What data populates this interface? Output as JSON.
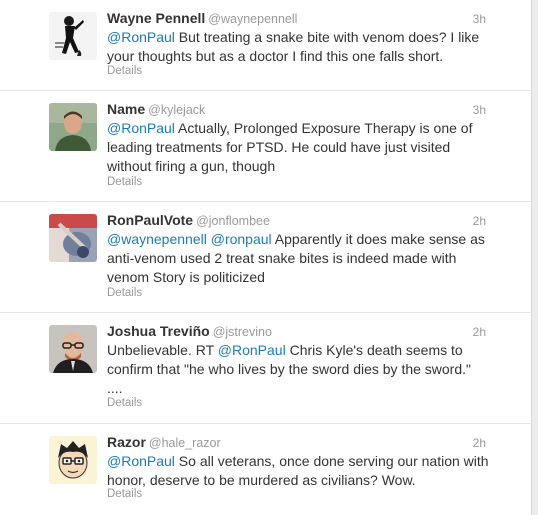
{
  "tweets": [
    {
      "name": "Wayne Pennell",
      "username": "@waynepennell",
      "time": "3h",
      "text": [
        {
          "t": "mention",
          "v": "@RonPaul"
        },
        {
          "t": "text",
          "v": " But treating a snake bite with venom does? I like your thoughts but as a doctor I find this one falls short."
        }
      ],
      "details_label": "Details",
      "avatar_icon": "woman-silhouette-avatar"
    },
    {
      "name": "Name",
      "username": "@kylejack",
      "time": "3h",
      "text": [
        {
          "t": "mention",
          "v": "@RonPaul"
        },
        {
          "t": "text",
          "v": " Actually, Prolonged Exposure Therapy is one of leading treatments for PTSD. He could have just visited without firing a gun, though"
        }
      ],
      "details_label": "Details",
      "avatar_icon": "man-portrait-avatar"
    },
    {
      "name": "RonPaulVote",
      "username": "@jonflombee",
      "time": "2h",
      "text": [
        {
          "t": "mention",
          "v": "@waynepennell"
        },
        {
          "t": "text",
          "v": " "
        },
        {
          "t": "mention",
          "v": "@ronpaul"
        },
        {
          "t": "text",
          "v": " Apparently it does make sense as anti-venom used 2 treat snake bites is indeed made with venom Story is politicized"
        }
      ],
      "details_label": "Details",
      "avatar_icon": "blurred-photo-avatar"
    },
    {
      "name": "Joshua Treviño",
      "username": "@jstrevino",
      "time": "2h",
      "text": [
        {
          "t": "text",
          "v": "Unbelievable. RT "
        },
        {
          "t": "mention",
          "v": "@RonPaul"
        },
        {
          "t": "text",
          "v": " Chris Kyle's death seems to confirm that \"he who lives by the sword dies by the sword.\" ...."
        }
      ],
      "details_label": "Details",
      "avatar_icon": "bald-man-glasses-avatar"
    },
    {
      "name": "Razor",
      "username": "@hale_razor",
      "time": "2h",
      "text": [
        {
          "t": "mention",
          "v": "@RonPaul"
        },
        {
          "t": "text",
          "v": " So all veterans, once done serving our nation with honor, deserve to be murdered as civilians? Wow."
        }
      ],
      "details_label": "Details",
      "avatar_icon": "cartoon-face-avatar"
    }
  ],
  "colors": {
    "link": "#1a7bb9",
    "muted": "#999999",
    "text": "#333333",
    "divider": "#e6e6e6"
  }
}
